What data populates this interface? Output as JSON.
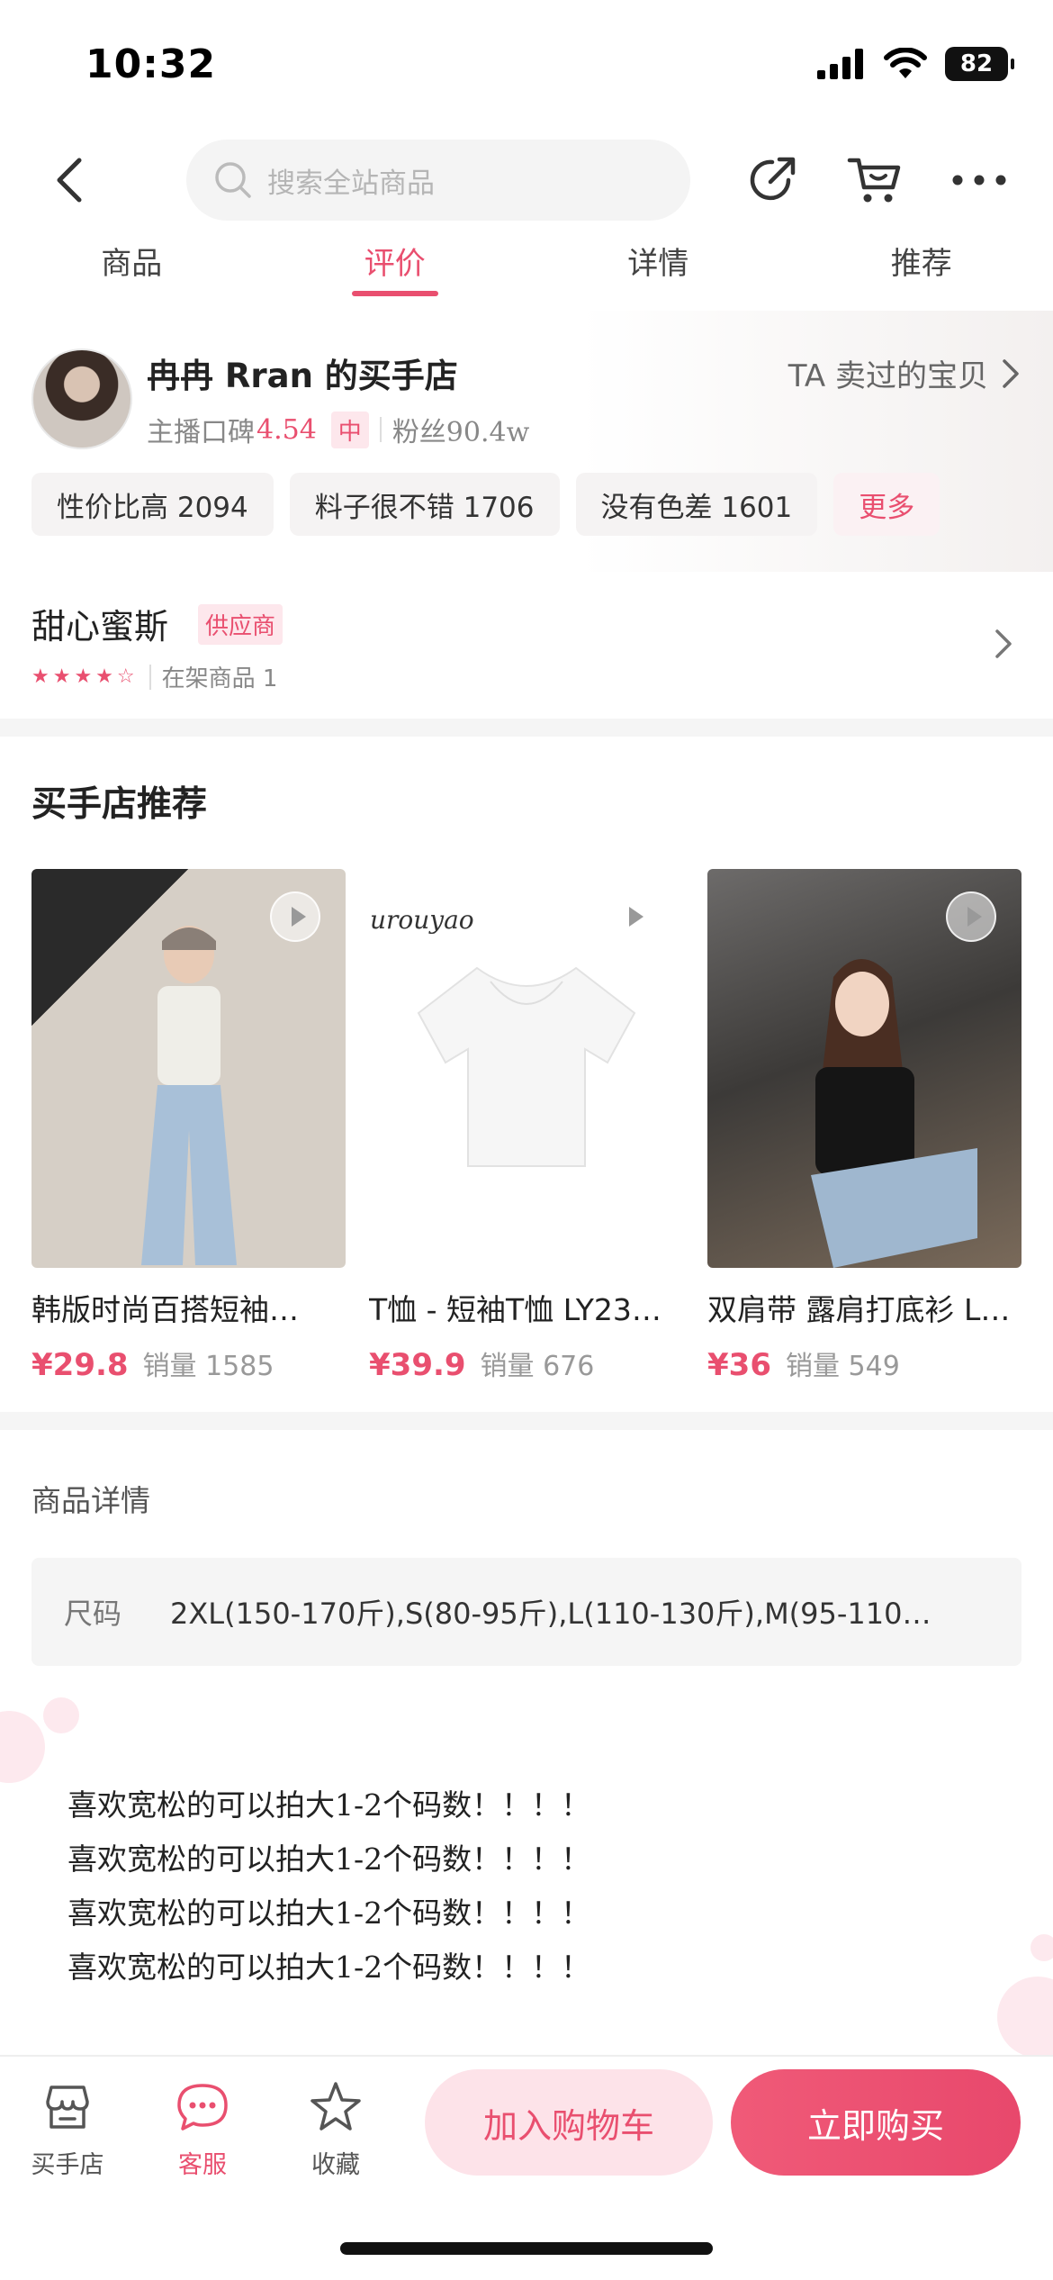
{
  "status_bar": {
    "time": "10:32",
    "battery": "82"
  },
  "nav": {
    "search_placeholder": "搜索全站商品"
  },
  "tabs": [
    {
      "label": "商品",
      "active": false
    },
    {
      "label": "评价",
      "active": true
    },
    {
      "label": "详情",
      "active": false
    },
    {
      "label": "推荐",
      "active": false
    }
  ],
  "host": {
    "name": "冉冉 Rran 的买手店",
    "rating_label": "主播口碑",
    "rating_value": "4.54",
    "rating_level": "中",
    "fans": "粉丝90.4w",
    "link_label": "TA 卖过的宝贝",
    "tags": [
      "性价比高 2094",
      "料子很不错 1706",
      "没有色差 1601"
    ],
    "more_label": "更多"
  },
  "supplier": {
    "name": "甜心蜜斯",
    "badge": "供应商",
    "rating": 4.5,
    "stars": "★★★★☆",
    "on_shelf": "在架商品 1"
  },
  "recommend": {
    "title": "买手店推荐",
    "products": [
      {
        "name": "韩版时尚百搭短袖…",
        "price": "¥29.8",
        "sales": "销量 1585"
      },
      {
        "name": "T恤 - 短袖T恤 LY23…",
        "price": "¥39.9",
        "sales": "销量 676"
      },
      {
        "name": "双肩带 露肩打底衫 L…",
        "price": "¥36",
        "sales": "销量 549"
      }
    ],
    "watermark": "iurouyao"
  },
  "details": {
    "title": "商品详情",
    "size_label": "尺码",
    "size_value": "2XL(150-170斤),S(80-95斤),L(110-130斤),M(95-110…",
    "lines": [
      "喜欢宽松的可以拍大1-2个码数！！！！",
      "喜欢宽松的可以拍大1-2个码数！！！！",
      "喜欢宽松的可以拍大1-2个码数！！！！",
      "喜欢宽松的可以拍大1-2个码数！！！！"
    ]
  },
  "bottom": {
    "shop_label": "买手店",
    "service_label": "客服",
    "favorite_label": "收藏",
    "add_cart_label": "加入购物车",
    "buy_now_label": "立即购买"
  },
  "colors": {
    "accent": "#e94f6f",
    "accent_light": "#fde3e9"
  }
}
